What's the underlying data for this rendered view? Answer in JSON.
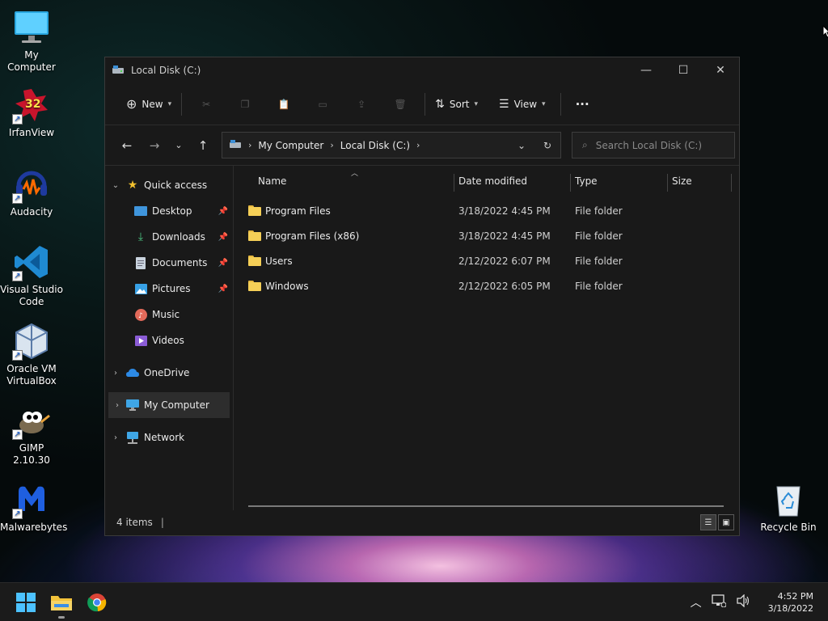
{
  "desktop": {
    "icons": [
      {
        "label": "My Computer",
        "name": "my-computer"
      },
      {
        "label": "IrfanView",
        "name": "irfanview"
      },
      {
        "label": "Audacity",
        "name": "audacity"
      },
      {
        "label": "Visual Studio Code",
        "name": "vscode"
      },
      {
        "label": "Oracle VM VirtualBox",
        "name": "virtualbox"
      },
      {
        "label": "GIMP 2.10.30",
        "name": "gimp"
      },
      {
        "label": "Malwarebytes",
        "name": "malwarebytes"
      },
      {
        "label": "Recycle Bin",
        "name": "recycle-bin"
      }
    ],
    "irfanview_badge": "32"
  },
  "window": {
    "title": "Local Disk (C:)",
    "toolbar": {
      "new_label": "New",
      "sort_label": "Sort",
      "view_label": "View",
      "more_label": "···"
    },
    "address": {
      "crumbs": [
        "My Computer",
        "Local Disk (C:)"
      ]
    },
    "search": {
      "placeholder": "Search Local Disk (C:)"
    },
    "nav": {
      "quick_access": "Quick access",
      "desktop": "Desktop",
      "downloads": "Downloads",
      "documents": "Documents",
      "pictures": "Pictures",
      "music": "Music",
      "videos": "Videos",
      "onedrive": "OneDrive",
      "my_computer": "My Computer",
      "network": "Network"
    },
    "columns": {
      "name": "Name",
      "date": "Date modified",
      "type": "Type",
      "size": "Size"
    },
    "files": [
      {
        "name": "Program Files",
        "date": "3/18/2022 4:45 PM",
        "type": "File folder"
      },
      {
        "name": "Program Files (x86)",
        "date": "3/18/2022 4:45 PM",
        "type": "File folder"
      },
      {
        "name": "Users",
        "date": "2/12/2022 6:07 PM",
        "type": "File folder"
      },
      {
        "name": "Windows",
        "date": "2/12/2022 6:05 PM",
        "type": "File folder"
      }
    ],
    "status": {
      "items": "4 items",
      "cursor": "|"
    }
  },
  "taskbar": {
    "time": "4:52 PM",
    "date": "3/18/2022"
  },
  "colors": {
    "folder": "#f5cf57",
    "accent": "#4cc2ff",
    "window_bg": "#191919"
  }
}
